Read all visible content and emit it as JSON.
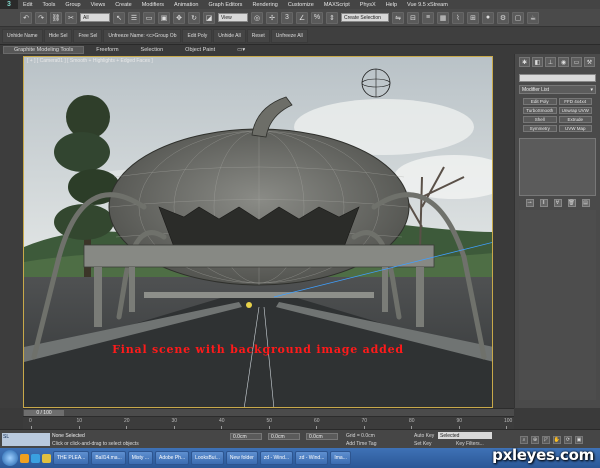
{
  "menubar": {
    "logo": "3",
    "items": [
      "Edit",
      "Tools",
      "Group",
      "Views",
      "Create",
      "Modifiers",
      "Animation",
      "Graph Editors",
      "Rendering",
      "Customize",
      "MAXScript",
      "PhysX",
      "Help",
      "Vue 9.5 xStream"
    ]
  },
  "toolbar": {
    "filter_value": "All",
    "view_value": "View",
    "selection_set_placeholder": "Create Selection"
  },
  "quickbar": {
    "items": [
      "Unhide Name",
      "Hide Sel",
      "Free Sel",
      "Unfreeze Name: <c>Group Ob",
      "Edit Poly",
      "Unhide All",
      "Reset",
      "Unfreeze All"
    ]
  },
  "ribbon": {
    "tabs": [
      "Graphite Modeling Tools",
      "Freeform",
      "Selection",
      "Object Paint"
    ]
  },
  "viewport": {
    "label": "[ + ] [ Camera01 ] [ Smooth + Highlights + Edged Faces ]",
    "caption": "Final scene with background image added"
  },
  "command_panel": {
    "modifier_list_label": "Modifier List",
    "modifiers": [
      "Edit Poly",
      "FFD 4x4x4",
      "TurboSmooth",
      "Unwrap UVW",
      "Shell",
      "Extrude",
      "Symmetry",
      "UVW Map"
    ]
  },
  "timeline": {
    "frame_label": "0 / 100",
    "ticks": [
      "0",
      "10",
      "20",
      "30",
      "40",
      "50",
      "60",
      "70",
      "80",
      "90",
      "100"
    ]
  },
  "status": {
    "listener": "SL",
    "selection": "None Selected",
    "prompt": "Click or click-and-drag to select objects",
    "x_value": "0.0cm",
    "y_value": "0.0cm",
    "z_value": "0.0cm",
    "grid": "Grid = 0.0cm",
    "add_time_tag": "Add Time Tag",
    "auto_key": "Auto Key",
    "set_key": "Set Key",
    "selected_dropdown": "Selected",
    "key_filters": "Key Filters..."
  },
  "taskbar": {
    "items": [
      "THE PLEA...",
      "Ball14.ma...",
      "Misty ...",
      "Adobe Ph...",
      "LooksBui...",
      "New folder",
      "zd - Wind...",
      "zd - Wind...",
      "Ima..."
    ]
  },
  "watermark": "pxleyes.com",
  "colors": {
    "viewport_border": "#c8a94a",
    "caption": "#ff1a1a",
    "taskbar": "#2b5796"
  }
}
